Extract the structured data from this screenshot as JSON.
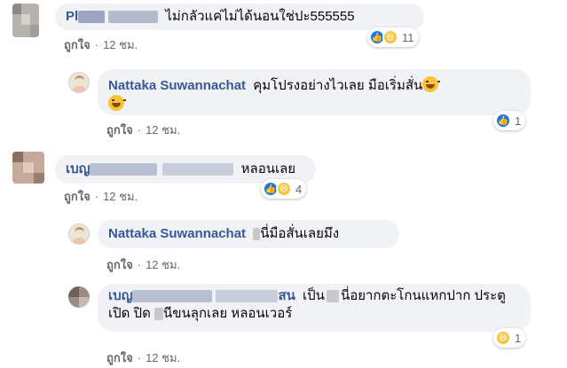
{
  "comments": [
    {
      "author_visible": "Pl",
      "text": "ไม่กลัวแค่ไม่ได้นอนใช่ปะ555555",
      "like_label": "ถูกใจ",
      "time": "12 ชม.",
      "reaction_count": "11",
      "reactions": [
        "like-icon",
        "haha-icon"
      ]
    },
    {
      "author": "Nattaka Suwannachat",
      "text": "คุมโปรงอย่างไวเลย มือเริ่มสั่น",
      "like_label": "ถูกใจ",
      "time": "12 ชม.",
      "reaction_count": "1",
      "reactions": [
        "like-icon"
      ]
    },
    {
      "author_visible": "เบญ",
      "text": "หลอนเลย",
      "like_label": "ถูกใจ",
      "time": "12 ชม.",
      "reaction_count": "4",
      "reactions": [
        "like-icon",
        "haha-icon"
      ]
    },
    {
      "author": "Nattaka Suwannachat",
      "text": "นี่มือสั่นเลยมึง",
      "like_label": "ถูกใจ",
      "time": "12 ชม."
    },
    {
      "author_visible": "เบญ",
      "author_suffix": "สน",
      "text_line1": "เป็น",
      "text_line1b": "นี่อยากตะโกนแหกปาก ประตู",
      "text_line2a": "เปิด ปิด",
      "text_line2b": "นีขนลุกเลย หลอนเวอร์",
      "like_label": "ถูกใจ",
      "time": "12 ชม.",
      "reaction_count": "1",
      "reactions": [
        "haha-icon"
      ]
    }
  ],
  "colors": {
    "author": "#385898",
    "bubble": "#f0f2f5",
    "meta": "#65676b",
    "like_blue": "#1877f2",
    "haha_yellow": "#f7c33b"
  },
  "separator": "·"
}
